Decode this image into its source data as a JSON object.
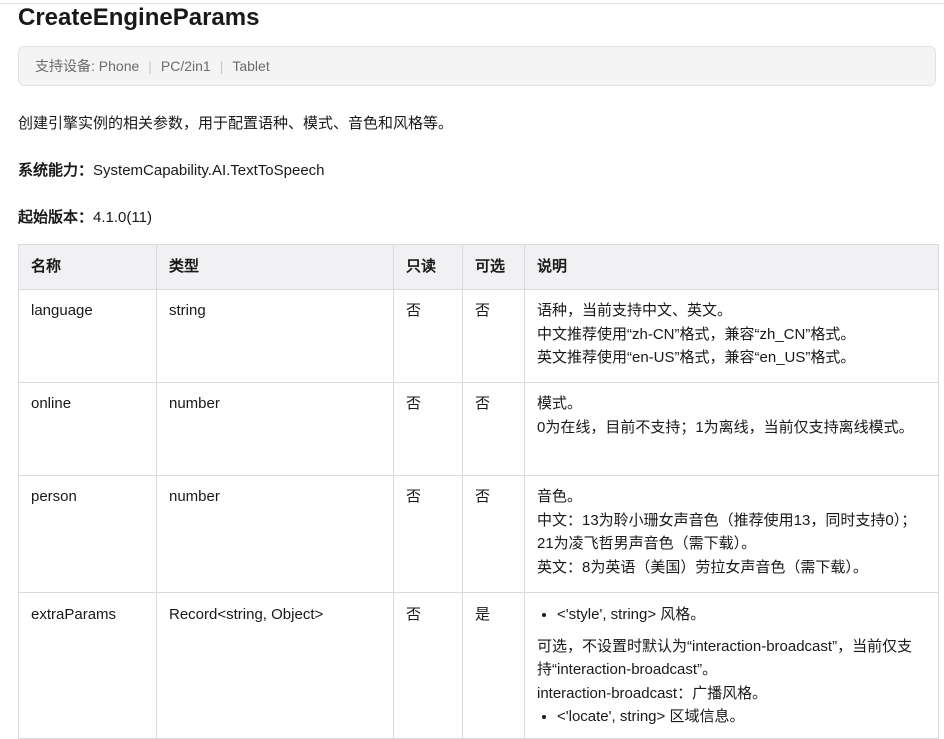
{
  "page_title": "CreateEngineParams",
  "devices": {
    "label": "支持设备: Phone",
    "items": [
      "PC/2in1",
      "Tablet"
    ]
  },
  "description": "创建引擎实例的相关参数，用于配置语种、模式、音色和风格等。",
  "system_capability": {
    "label": "系统能力：",
    "value": "SystemCapability.AI.TextToSpeech"
  },
  "since_version": {
    "label": "起始版本：",
    "value": "4.1.0(11)"
  },
  "table": {
    "headers": [
      "名称",
      "类型",
      "只读",
      "可选",
      "说明"
    ],
    "rows": [
      {
        "name": "language",
        "type": "string",
        "readonly": "否",
        "optional": "否",
        "desc": [
          "语种，当前支持中文、英文。",
          "中文推荐使用“zh-CN”格式，兼容“zh_CN”格式。",
          "英文推荐使用“en-US”格式，兼容“en_US”格式。"
        ]
      },
      {
        "name": "online",
        "type": "number",
        "readonly": "否",
        "optional": "否",
        "desc": [
          "模式。",
          "0为在线，目前不支持；1为离线，当前仅支持离线模式。"
        ]
      },
      {
        "name": "person",
        "type": "number",
        "readonly": "否",
        "optional": "否",
        "desc": [
          "音色。",
          "中文：13为聆小珊女声音色（推荐使用13，同时支持0）；21为凌飞哲男声音色（需下载）。",
          "英文：8为英语（美国）劳拉女声音色（需下载）。"
        ]
      },
      {
        "name": "extraParams",
        "type": "Record<string, Object>",
        "readonly": "否",
        "optional": "是",
        "bullet1": "<'style', string> 风格。",
        "desc": [
          "可选，不设置时默认为“interaction-broadcast”，当前仅支持“interaction-broadcast”。",
          "interaction-broadcast：广播风格。"
        ],
        "bullet2": "<'locate', string> 区域信息。"
      }
    ]
  }
}
